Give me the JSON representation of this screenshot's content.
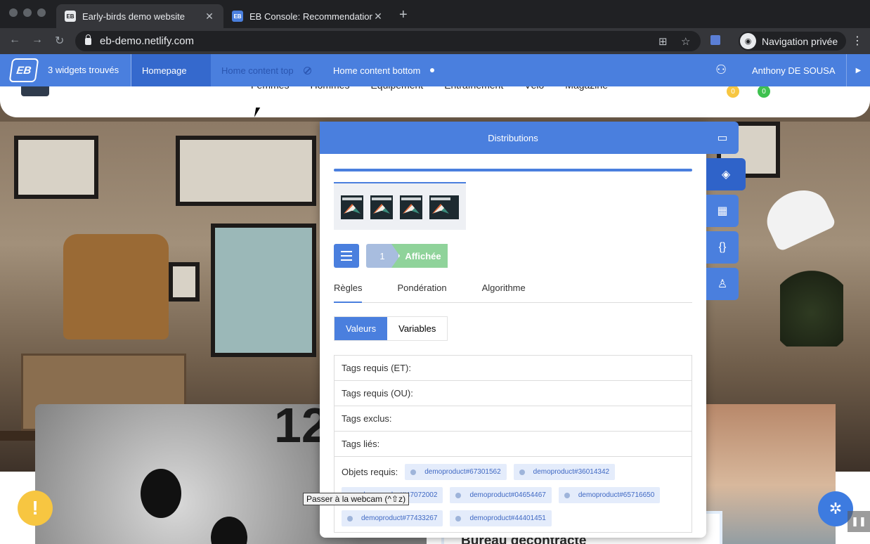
{
  "browser": {
    "tabs": [
      {
        "title": "Early-birds demo website",
        "favicon": "EB",
        "active": true
      },
      {
        "title": "EB Console: Recommendation",
        "favicon": "EB",
        "active": false
      }
    ],
    "close_glyph": "✕",
    "new_tab_glyph": "+",
    "url": "eb-demo.netlify.com",
    "profile_label": "Navigation privée",
    "icons": [
      "back-icon",
      "forward-icon",
      "reload-icon",
      "lock-icon",
      "translate-icon",
      "star-icon",
      "extension-icon",
      "incognito-icon",
      "menu-icon"
    ]
  },
  "eb_bar": {
    "logo": "EB",
    "widgets_found": "3 widgets trouvés",
    "tabs": [
      {
        "label": "Homepage",
        "state": "active"
      },
      {
        "label": "Home content top",
        "state": "disabled"
      },
      {
        "label": "Home content bottom",
        "state": "enabled"
      }
    ],
    "user_name": "Anthony DE SOUSA",
    "accent": "#4a7fde"
  },
  "site": {
    "nav": [
      "Femmes",
      "Hommes",
      "Équipement",
      "Entraînement",
      "Vélo",
      "Magazine"
    ],
    "cart_badges": [
      "0",
      "0"
    ],
    "product_title": "Bureau décontracté",
    "alert_glyph": "!"
  },
  "panel": {
    "title": "Distributions",
    "thumbnails_count": 4,
    "step_number": "1",
    "step_label": "Affichée",
    "tabs": [
      "Règles",
      "Pondération",
      "Algorithme"
    ],
    "segments": [
      "Valeurs",
      "Variables"
    ],
    "rules": [
      "Tags requis (ET):",
      "Tags requis (OU):",
      "Tags exclus:",
      "Tags liés:"
    ],
    "objects_label": "Objets requis:",
    "objects": [
      "demoproduct#67301562",
      "demoproduct#36014342",
      "demoproduct#47072002",
      "demoproduct#04654467",
      "demoproduct#65716650",
      "demoproduct#77433267",
      "demoproduct#44401451"
    ]
  },
  "tooltip": "Passer à la webcam (^⇧z)"
}
